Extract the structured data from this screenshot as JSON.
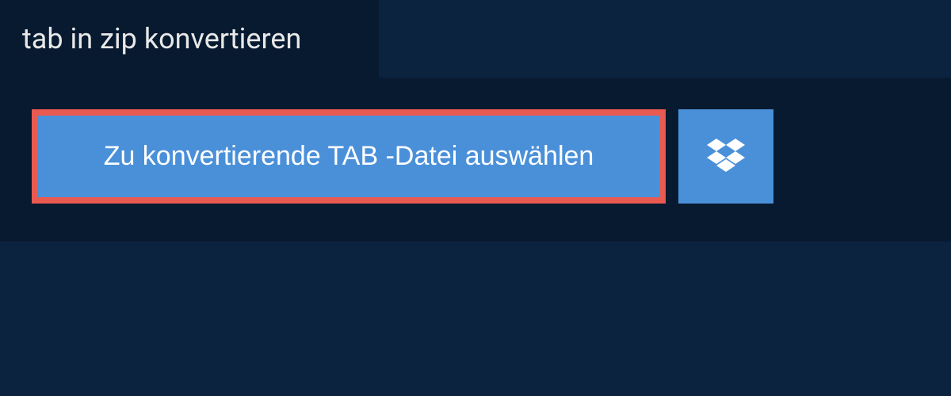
{
  "header": {
    "title": "tab in zip konvertieren"
  },
  "actions": {
    "select_file_label": "Zu konvertierende TAB -Datei auswählen",
    "dropbox_icon": "dropbox-icon"
  },
  "colors": {
    "bg_outer": "#0c2340",
    "bg_panel": "#071a30",
    "button_bg": "#4a90d9",
    "button_border": "#e85a4f",
    "text_light": "#e8e8e8"
  }
}
